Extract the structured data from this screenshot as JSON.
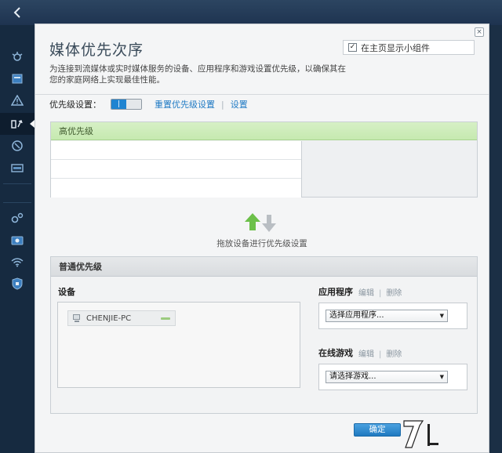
{
  "dialog": {
    "title": "媒体优先次序",
    "close_symbol": "×",
    "widget_checkbox": {
      "checked": true,
      "label": "在主页显示小组件"
    },
    "description": "为连接到流媒体或实时媒体服务的设备、应用程序和游戏设置优先级，以确保其在您的家庭网络上实现最佳性能。"
  },
  "priority": {
    "label": "优先级设置：",
    "reset_link": "重置优先级设置",
    "separator": "|",
    "settings_link": "设置"
  },
  "high_priority": {
    "header": "高优先级",
    "rows": [
      "",
      "",
      ""
    ]
  },
  "drag_hint": "拖放设备进行优先级设置",
  "normal_priority": {
    "header": "普通优先级",
    "devices_label": "设备",
    "devices": [
      {
        "name": "CHENJIE-PC",
        "icon": "computer-icon"
      }
    ],
    "apps": {
      "label": "应用程序",
      "edit": "编辑",
      "separator": "|",
      "delete": "删除",
      "select_value": "选择应用程序..."
    },
    "games": {
      "label": "在线游戏",
      "edit": "编辑",
      "separator": "|",
      "delete": "删除",
      "select_value": "请选择游戏..."
    }
  },
  "ok_button": "确定",
  "colors": {
    "accent_blue": "#1f84d1",
    "high_priority_green": "#c6e9b0",
    "arrow_green": "#6cc04a",
    "arrow_gray": "#b9bec3"
  },
  "sidebar_icons": [
    "router-icon",
    "calendar-icon",
    "warning-icon",
    "media-priority-icon",
    "speedtest-icon",
    "storage-icon",
    "settings-icon",
    "camera-icon",
    "wifi-icon",
    "security-icon"
  ]
}
